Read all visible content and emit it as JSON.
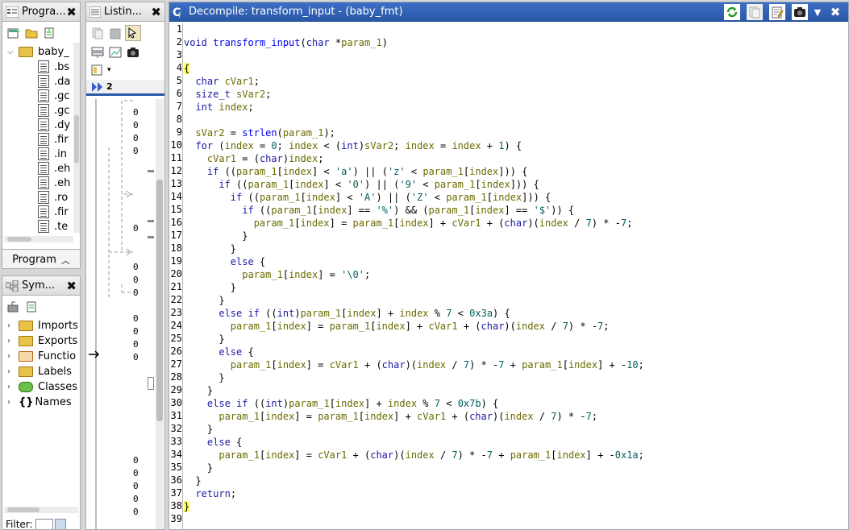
{
  "program_tree": {
    "title": "Progra...",
    "root_label": "baby_",
    "items": [
      ".bs",
      ".da",
      ".gc",
      ".gc",
      ".dy",
      ".fir",
      ".in",
      ".eh",
      ".eh",
      ".ro",
      ".fir",
      ".te"
    ],
    "tab_label": "Program"
  },
  "symbol_tree": {
    "title": "Sym...",
    "items": [
      "Imports",
      "Exports",
      "Functio",
      "Labels",
      "Classes",
      "Names"
    ],
    "filter_label": "Filter:"
  },
  "listing": {
    "title": "Listin...",
    "offset_prefix": "2",
    "addresses_top": [
      "0",
      "0",
      "0",
      "0",
      "0"
    ],
    "addresses_mid": [
      "0"
    ],
    "addresses_lower": [
      "0",
      "0",
      "0"
    ],
    "addresses_lower2": [
      "0",
      "0",
      "0",
      "0"
    ],
    "addresses_bottom": [
      "0",
      "0",
      "0",
      "0",
      "0"
    ]
  },
  "decompile": {
    "title": "Decompile: transform_input -  (baby_fmt)",
    "lines": [
      "",
      "void transform_input(char *param_1)",
      "",
      "{",
      "  char cVar1;",
      "  size_t sVar2;",
      "  int index;",
      "",
      "  sVar2 = strlen(param_1);",
      "  for (index = 0; index < (int)sVar2; index = index + 1) {",
      "    cVar1 = (char)index;",
      "    if ((param_1[index] < 'a') || ('z' < param_1[index])) {",
      "      if ((param_1[index] < '0') || ('9' < param_1[index])) {",
      "        if ((param_1[index] < 'A') || ('Z' < param_1[index])) {",
      "          if ((param_1[index] == '%') && (param_1[index] == '$')) {",
      "            param_1[index] = param_1[index] + cVar1 + (char)(index / 7) * -7;",
      "          }",
      "        }",
      "        else {",
      "          param_1[index] = '\\0';",
      "        }",
      "      }",
      "      else if ((int)param_1[index] + index % 7 < 0x3a) {",
      "        param_1[index] = param_1[index] + cVar1 + (char)(index / 7) * -7;",
      "      }",
      "      else {",
      "        param_1[index] = cVar1 + (char)(index / 7) * -7 + param_1[index] + -10;",
      "      }",
      "    }",
      "    else if ((int)param_1[index] + index % 7 < 0x7b) {",
      "      param_1[index] = param_1[index] + cVar1 + (char)(index / 7) * -7;",
      "    }",
      "    else {",
      "      param_1[index] = cVar1 + (char)(index / 7) * -7 + param_1[index] + -0x1a;",
      "    }",
      "  }",
      "  return;",
      "}",
      ""
    ]
  },
  "colors": {
    "keyword": "#1a1aa6",
    "variable": "#6b6b00",
    "constant": "#006060",
    "function": "#0000ee",
    "brace_highlight": "#ffff66",
    "title_active": "#2a58a8"
  }
}
